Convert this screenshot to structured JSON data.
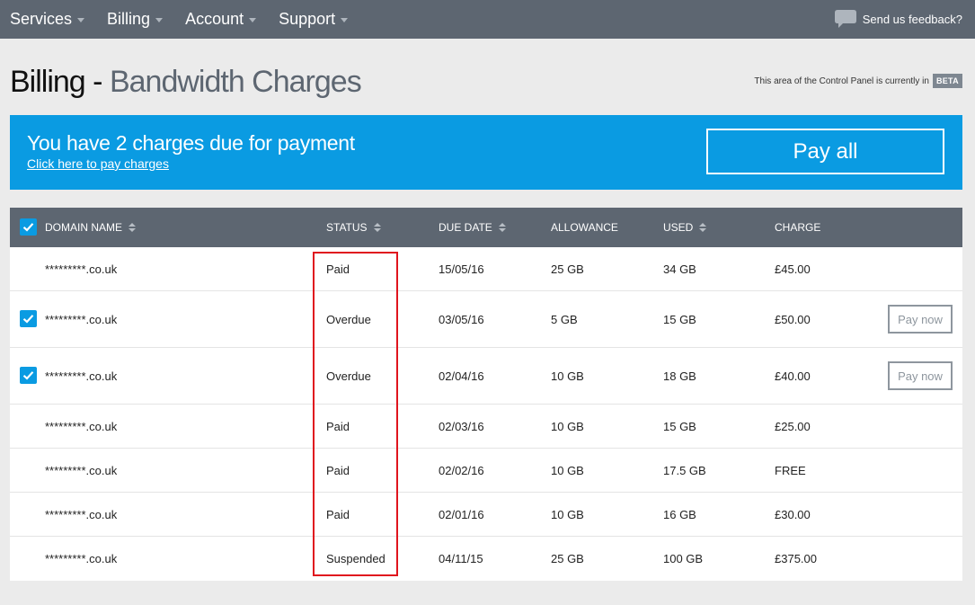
{
  "nav": {
    "items": [
      "Services",
      "Billing",
      "Account",
      "Support"
    ],
    "feedback_label": "Send us feedback?"
  },
  "page": {
    "title_section": "Billing",
    "title_separator": "-",
    "title_page": "Bandwidth Charges",
    "beta_note": "This area of the Control Panel is currently in",
    "beta_badge": "BETA"
  },
  "banner": {
    "heading": "You have 2 charges due for payment",
    "link": "Click here to pay charges",
    "pay_all_label": "Pay all",
    "color": "#0a9be2"
  },
  "table": {
    "columns": [
      "DOMAIN NAME",
      "STATUS",
      "DUE DATE",
      "ALLOWANCE",
      "USED",
      "CHARGE"
    ],
    "sortable": [
      true,
      true,
      true,
      false,
      true,
      false
    ],
    "header_checked": true,
    "rows": [
      {
        "checked": false,
        "domain": "*********.co.uk",
        "status": "Paid",
        "due": "15/05/16",
        "allowance": "25 GB",
        "used": "34 GB",
        "charge": "£45.00",
        "action": ""
      },
      {
        "checked": true,
        "domain": "*********.co.uk",
        "status": "Overdue",
        "due": "03/05/16",
        "allowance": "5 GB",
        "used": "15 GB",
        "charge": "£50.00",
        "action": "Pay now"
      },
      {
        "checked": true,
        "domain": "*********.co.uk",
        "status": "Overdue",
        "due": "02/04/16",
        "allowance": "10 GB",
        "used": "18 GB",
        "charge": "£40.00",
        "action": "Pay now"
      },
      {
        "checked": false,
        "domain": "*********.co.uk",
        "status": "Paid",
        "due": "02/03/16",
        "allowance": "10 GB",
        "used": "15 GB",
        "charge": "£25.00",
        "action": ""
      },
      {
        "checked": false,
        "domain": "*********.co.uk",
        "status": "Paid",
        "due": "02/02/16",
        "allowance": "10 GB",
        "used": "17.5 GB",
        "charge": "FREE",
        "action": ""
      },
      {
        "checked": false,
        "domain": "*********.co.uk",
        "status": "Paid",
        "due": "02/01/16",
        "allowance": "10 GB",
        "used": "16 GB",
        "charge": "£30.00",
        "action": ""
      },
      {
        "checked": false,
        "domain": "*********.co.uk",
        "status": "Suspended",
        "due": "04/11/15",
        "allowance": "25 GB",
        "used": "100 GB",
        "charge": "£375.00",
        "action": ""
      }
    ]
  },
  "colors": {
    "nav_bg": "#5d6671",
    "accent": "#0a9be2",
    "highlight_box": "#e0141e"
  }
}
